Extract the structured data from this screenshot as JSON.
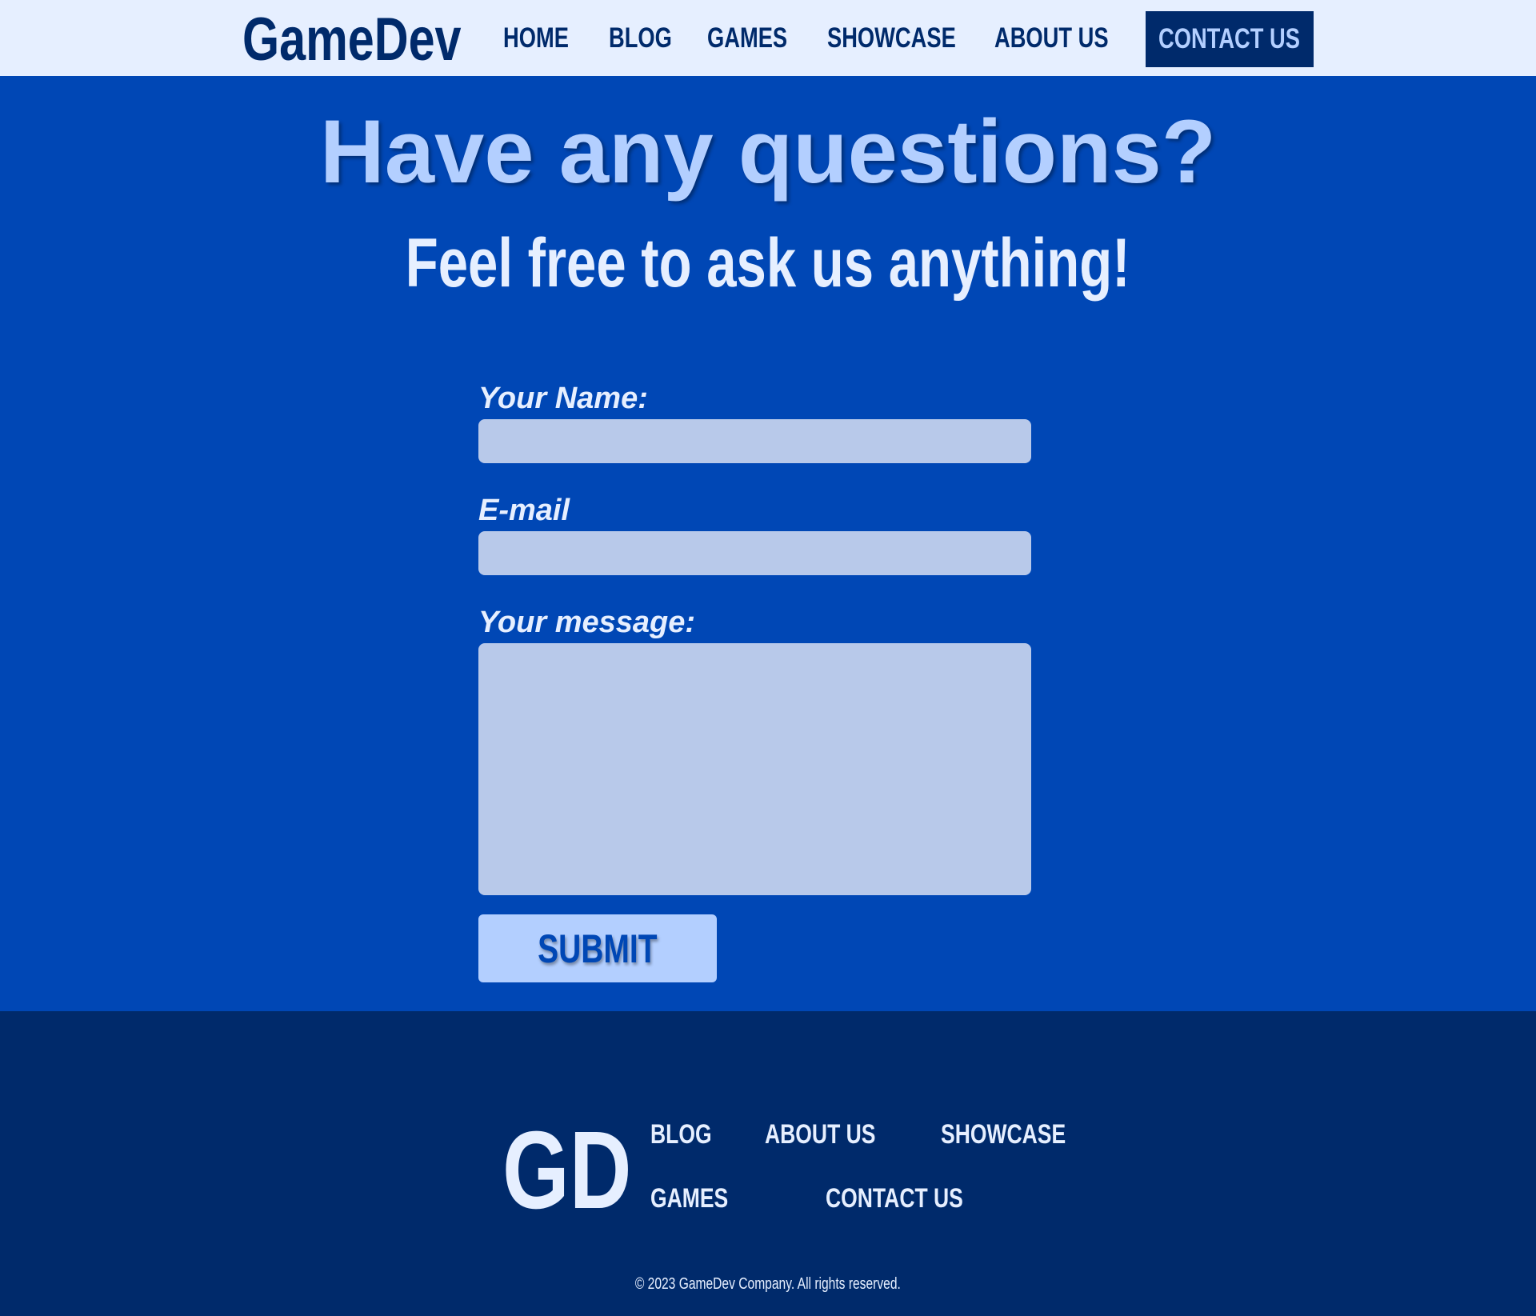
{
  "header": {
    "logo": "GameDev",
    "nav": [
      "HOME",
      "BLOG",
      "GAMES",
      "SHOWCASE",
      "ABOUT US"
    ],
    "cta": "CONTACT US"
  },
  "main": {
    "title": "Have any questions?",
    "subtitle": "Feel free to ask us anything!",
    "form": {
      "name_label": "Your Name:",
      "name_value": "",
      "email_label": "E-mail",
      "email_value": "",
      "message_label": "Your message:",
      "message_value": "",
      "submit": "SUBMIT"
    }
  },
  "footer": {
    "logo": "GD",
    "links": [
      "BLOG",
      "ABOUT US",
      "SHOWCASE",
      "GAMES",
      "CONTACT US"
    ],
    "copyright": "© 2023 GameDev Company. All rights reserved."
  },
  "colors": {
    "header_bg": "#e6efff",
    "main_bg": "#0047b5",
    "footer_bg": "#002a6b",
    "accent": "#b3cfff"
  }
}
